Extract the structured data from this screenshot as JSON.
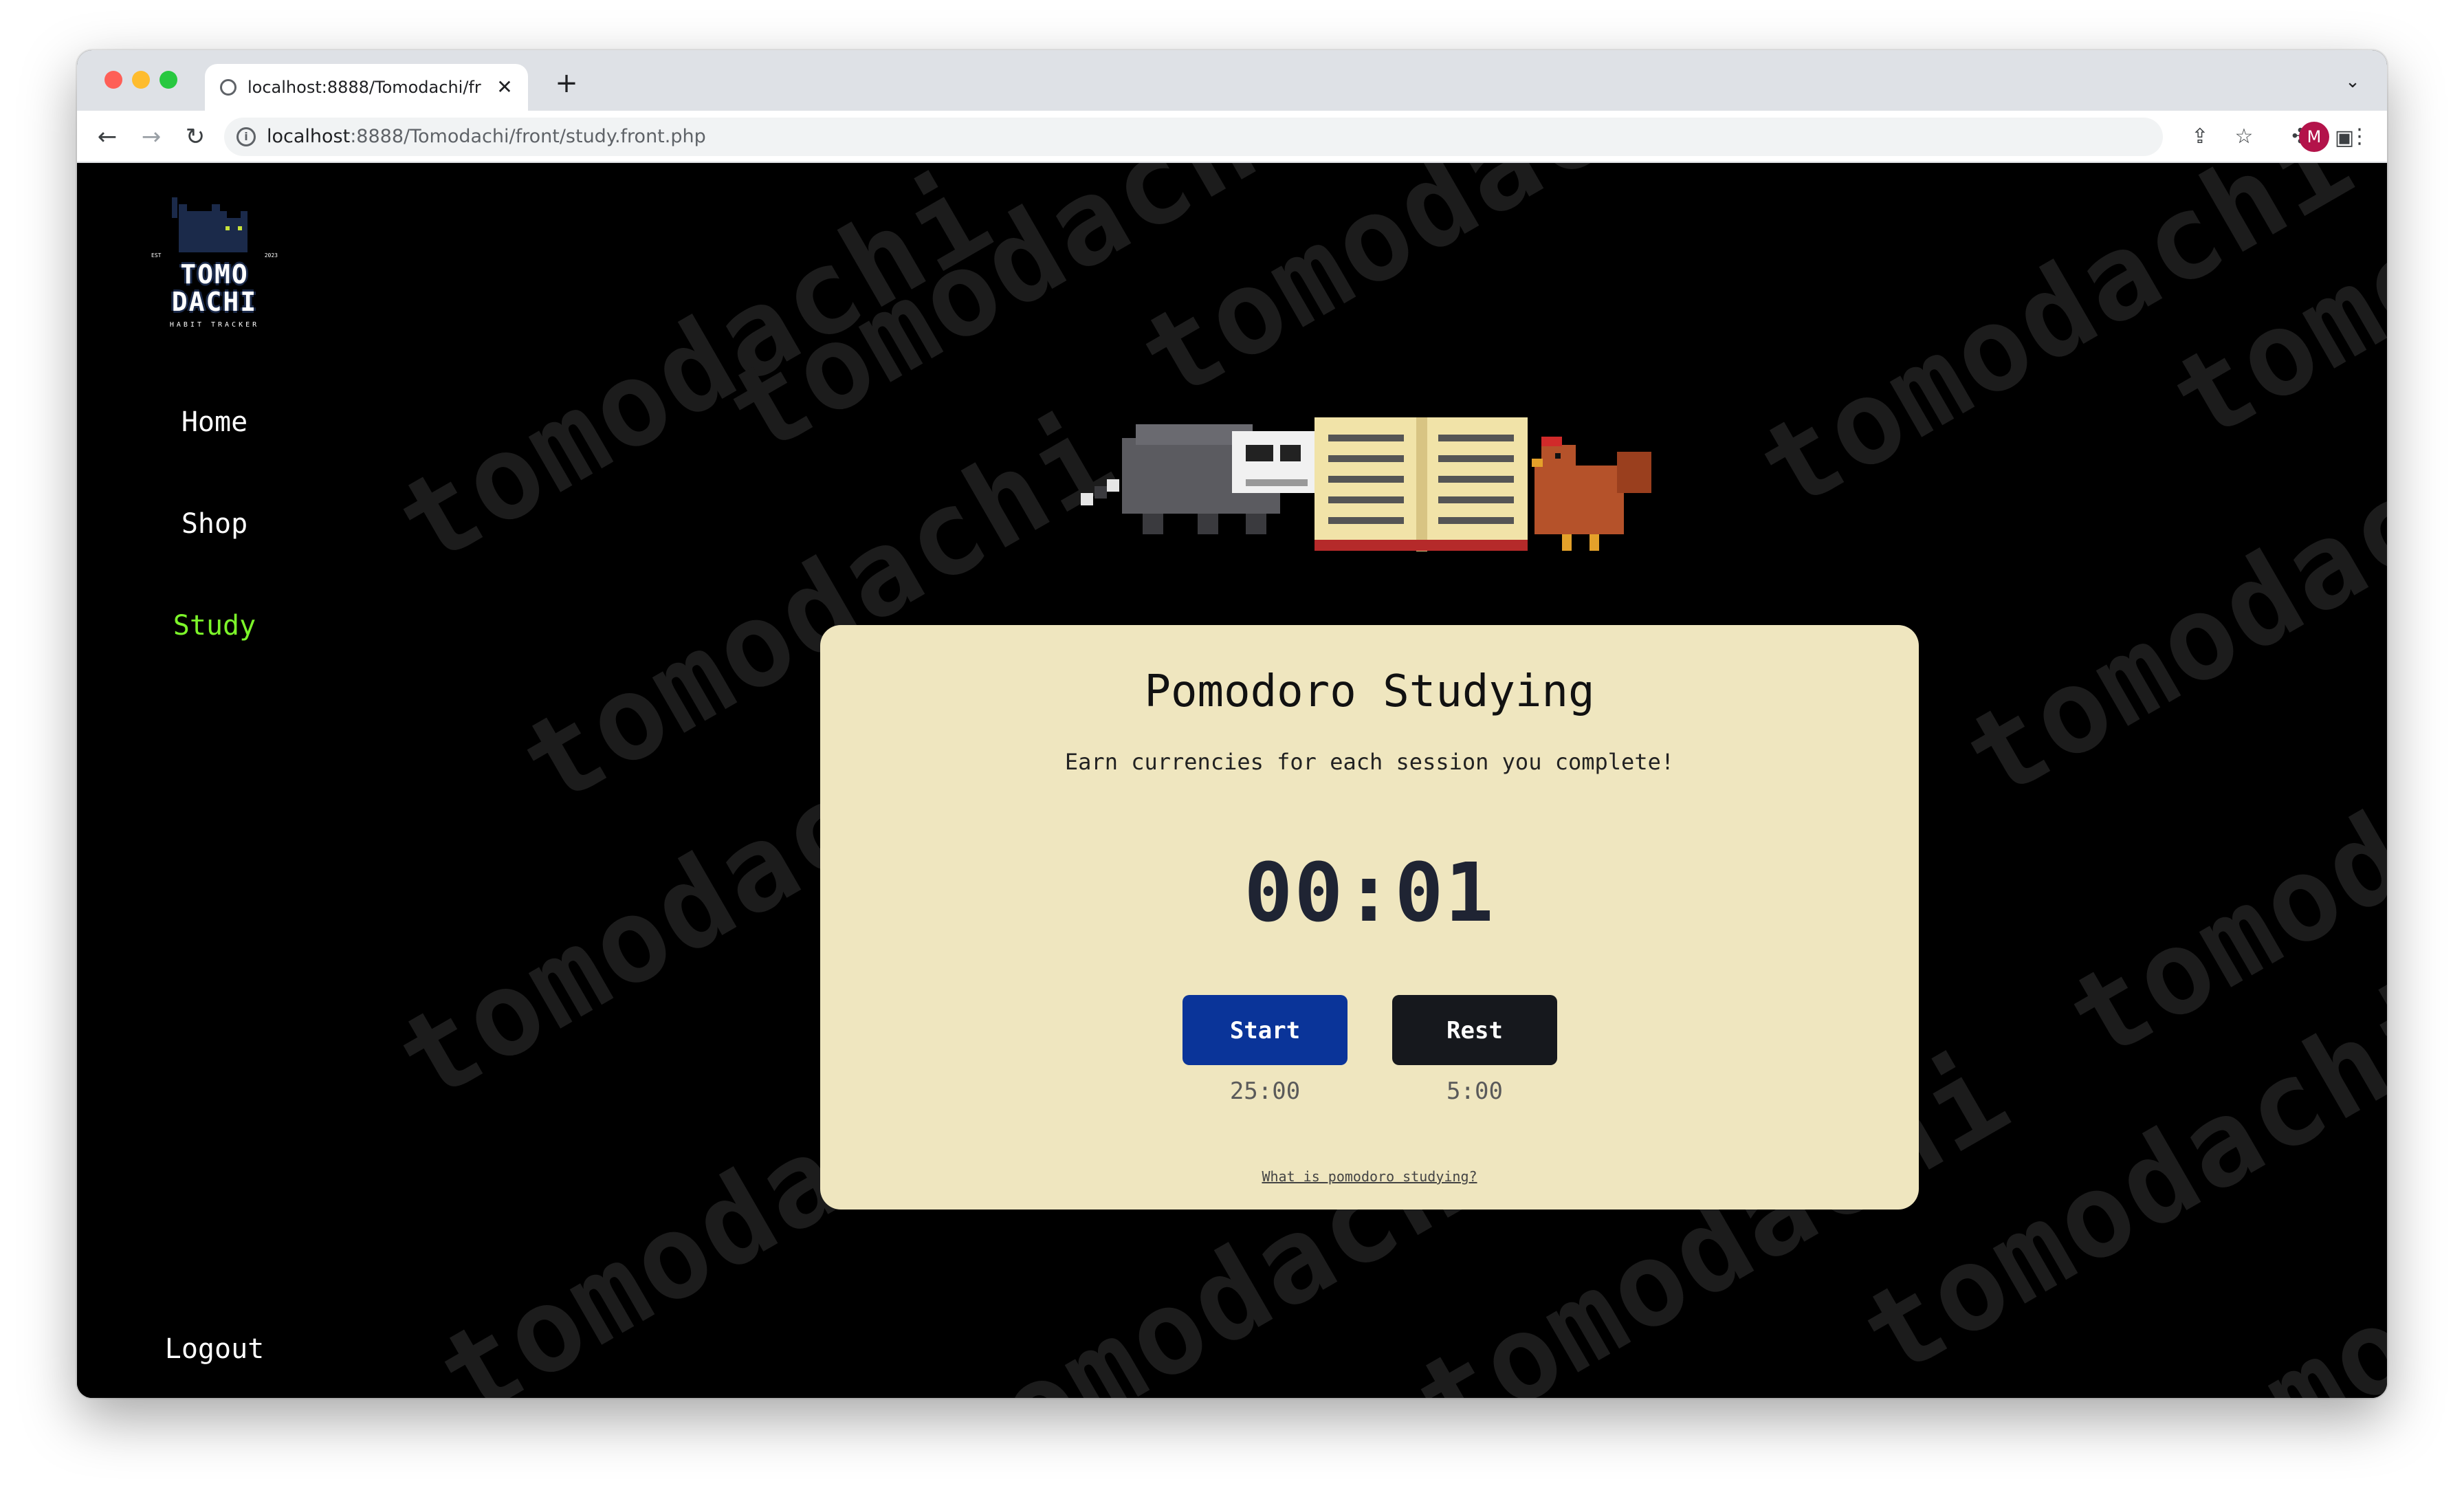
{
  "browser": {
    "tab_title": "localhost:8888/Tomodachi/front/study.front.php",
    "tab_close": "✕",
    "new_tab": "+",
    "url_host": "localhost",
    "url_path": ":8888/Tomodachi/front/study.front.php",
    "avatar_letter": "M"
  },
  "sidebar": {
    "logo_line1": "TOMO",
    "logo_line2": "DACHI",
    "logo_sub": "HABIT TRACKER",
    "logo_est": "EST",
    "logo_year": "2023",
    "nav": {
      "home": "Home",
      "shop": "Shop",
      "study": "Study",
      "logout": "Logout"
    },
    "active_color": "#7cf52a"
  },
  "watermark_text": "tomodachi",
  "card": {
    "title": "Pomodoro Studying",
    "subtitle": "Earn currencies for each session you complete!",
    "timer": "00:01",
    "start_label": "Start",
    "rest_label": "Rest",
    "start_duration": "25:00",
    "rest_duration": "5:00",
    "help_link": "What is pomodoro studying?",
    "start_color": "#0a3499",
    "rest_color": "#16181d",
    "background": "#efe6bf"
  }
}
